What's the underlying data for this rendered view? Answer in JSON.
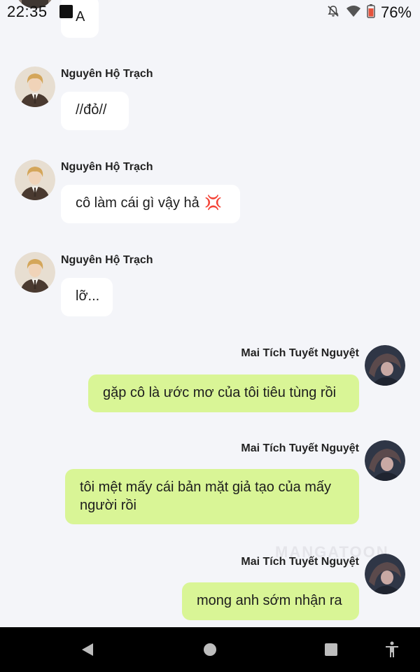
{
  "status_bar": {
    "time": "22:35",
    "battery": "76%",
    "icons": [
      "notification-square-icon",
      "mute-bell-icon",
      "wifi-icon",
      "battery-icon"
    ]
  },
  "top_partial_bubble": {
    "text": "A"
  },
  "messages": [
    {
      "side": "left",
      "sender": "Nguyên Hộ Trạch",
      "text": "//đỏ//"
    },
    {
      "side": "left",
      "sender": "Nguyên Hộ Trạch",
      "text": "cô làm cái gì vậy hả",
      "emoji": "💢"
    },
    {
      "side": "left",
      "sender": "Nguyên Hộ Trạch",
      "text": "lỡ..."
    },
    {
      "side": "right",
      "sender": "Mai Tích Tuyết Nguyệt",
      "text": "gặp cô là ước mơ của tôi tiêu tùng rồi"
    },
    {
      "side": "right",
      "sender": "Mai Tích Tuyết Nguyệt",
      "text": "tôi mệt mấy cái bản mặt giả tạo của mấy người rồi"
    },
    {
      "side": "right",
      "sender": "Mai Tích Tuyết Nguyệt",
      "text": "mong anh sớm nhận ra"
    }
  ],
  "watermark": "MANGATOON",
  "nav_bar": {
    "buttons": [
      "back-icon",
      "home-icon",
      "recents-icon",
      "accessibility-icon"
    ]
  },
  "colors": {
    "background": "#f4f5f9",
    "left_bubble": "#ffffff",
    "right_bubble": "#d9f596",
    "nav_bar": "#000000"
  }
}
